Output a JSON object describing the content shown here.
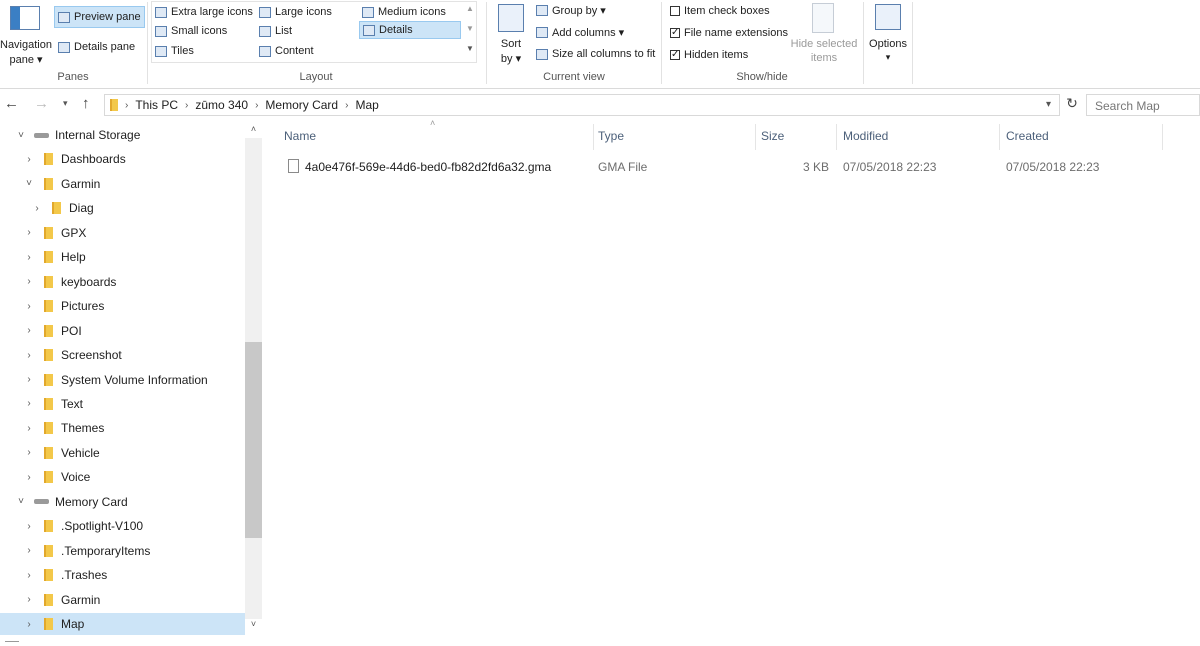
{
  "ribbon": {
    "panes": {
      "navigation_pane": "Navigation",
      "navigation_pane_2": "pane ▾",
      "preview_pane": "Preview pane",
      "details_pane": "Details pane",
      "label": "Panes"
    },
    "layout": {
      "extra_large": "Extra large icons",
      "large": "Large icons",
      "medium": "Medium icons",
      "small": "Small icons",
      "list": "List",
      "details": "Details",
      "tiles": "Tiles",
      "content": "Content",
      "label": "Layout"
    },
    "current_view": {
      "sort_by": "Sort",
      "sort_by_2": "by ▾",
      "group_by": "Group by ▾",
      "add_columns": "Add columns ▾",
      "size_all": "Size all columns to fit",
      "label": "Current view"
    },
    "show_hide": {
      "item_check_boxes": "Item check boxes",
      "file_name_extensions": "File name extensions",
      "hidden_items": "Hidden items",
      "hide_selected": "Hide selected",
      "hide_selected_2": "items",
      "label": "Show/hide"
    },
    "options": {
      "label": "Options",
      "arrow": "▾"
    }
  },
  "address": {
    "crumbs": [
      "This PC",
      "zūmo 340",
      "Memory Card",
      "Map"
    ],
    "search_placeholder": "Search Map"
  },
  "nav_tree": [
    {
      "label": "Internal Storage",
      "kind": "drive",
      "expanded": true,
      "level": 0
    },
    {
      "label": "Dashboards",
      "kind": "folder",
      "level": 1
    },
    {
      "label": "Garmin",
      "kind": "folder",
      "expanded": true,
      "level": 1
    },
    {
      "label": "Diag",
      "kind": "folder",
      "level": 2
    },
    {
      "label": "GPX",
      "kind": "folder",
      "level": 1
    },
    {
      "label": "Help",
      "kind": "folder",
      "level": 1
    },
    {
      "label": "keyboards",
      "kind": "folder",
      "level": 1
    },
    {
      "label": "Pictures",
      "kind": "folder",
      "level": 1
    },
    {
      "label": "POI",
      "kind": "folder",
      "level": 1
    },
    {
      "label": "Screenshot",
      "kind": "folder",
      "level": 1
    },
    {
      "label": "System Volume Information",
      "kind": "folder",
      "level": 1
    },
    {
      "label": "Text",
      "kind": "folder",
      "level": 1
    },
    {
      "label": "Themes",
      "kind": "folder",
      "level": 1
    },
    {
      "label": "Vehicle",
      "kind": "folder",
      "level": 1
    },
    {
      "label": "Voice",
      "kind": "folder",
      "level": 1
    },
    {
      "label": "Memory Card",
      "kind": "drive",
      "expanded": true,
      "level": 0
    },
    {
      "label": ".Spotlight-V100",
      "kind": "folder",
      "level": 1
    },
    {
      "label": ".TemporaryItems",
      "kind": "folder",
      "level": 1
    },
    {
      "label": ".Trashes",
      "kind": "folder",
      "level": 1
    },
    {
      "label": "Garmin",
      "kind": "folder",
      "level": 1
    },
    {
      "label": "Map",
      "kind": "folder",
      "level": 1,
      "selected": true
    }
  ],
  "file_list": {
    "columns": {
      "name": "Name",
      "type": "Type",
      "size": "Size",
      "modified": "Modified",
      "created": "Created"
    },
    "rows": [
      {
        "name": "4a0e476f-569e-44d6-bed0-fb82d2fd6a32.gma",
        "type": "GMA File",
        "size": "3 KB",
        "modified": "07/05/2018 22:23",
        "created": "07/05/2018 22:23"
      }
    ]
  },
  "colors": {
    "selection": "#cce4f7",
    "folder": "#f3c84a",
    "accent": "#0078d7"
  }
}
